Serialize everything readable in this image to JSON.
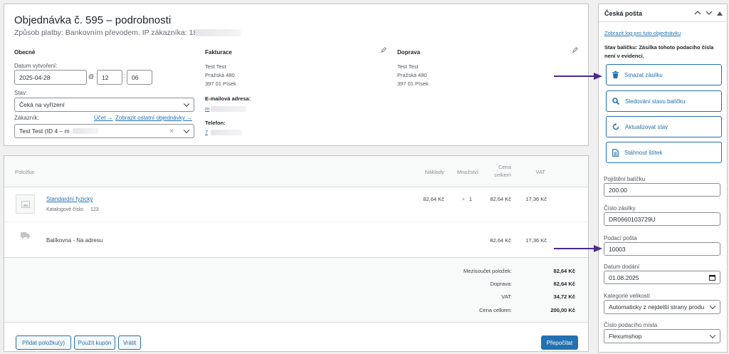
{
  "order": {
    "title": "Objednávka č. 595 – podrobnosti",
    "subtitle": "Způsob platby: Bankovním převodem. IP zákazníka: 18",
    "general": {
      "heading": "Obecné",
      "created_label": "Datum vytvoření:",
      "date": "2025-04-28",
      "at": "@",
      "hour": "12",
      "minute": "06",
      "status_label": "Stav:",
      "status_value": "Čeká na vyřízení",
      "customer_label": "Zákazník:",
      "account_link": "Účet →",
      "other_orders_link": "Zobrazit ostatní objednávky →",
      "customer_value": "Test Test (ID 4 – m",
      "clear": "×"
    },
    "billing": {
      "heading": "Fakturace",
      "lines": [
        "Test Test",
        "Pražská 480",
        "397 01 Písek"
      ],
      "email_label": "E-mailová adresa:",
      "email_value": "m",
      "phone_label": "Telefon:",
      "phone_value": "7"
    },
    "shipping": {
      "heading": "Doprava",
      "lines": [
        "Test Test",
        "Pražská 480",
        "397 01 Písek"
      ]
    }
  },
  "items": {
    "headers": {
      "item": "Položka",
      "cost": "Náklady",
      "qty": "Množství",
      "total_line1": "Cena",
      "total_line2": "celkem",
      "vat": "VAT"
    },
    "product": {
      "name": "Standardní fyzický",
      "sku_label": "Katalogové číslo:",
      "sku": "123",
      "cost": "82,64 Kč",
      "qty_x": "×",
      "qty": "1",
      "total": "82,64 Kč",
      "vat": "17,36 Kč"
    },
    "shipping_line": {
      "name": "Balíkovna - Na adresu",
      "total": "82,64 Kč",
      "vat": "17,36 Kč"
    },
    "totals": [
      {
        "label": "Mezisoučet položek:",
        "value": "82,64 Kč"
      },
      {
        "label": "Doprava:",
        "value": "82,64 Kč"
      },
      {
        "label": "VAT:",
        "value": "34,72 Kč"
      },
      {
        "label": "Cena celkem:",
        "value": "200,00 Kč"
      }
    ],
    "buttons": {
      "add_item": "Přidat položku(y)",
      "coupon": "Použít kupón",
      "refund": "Vrátit",
      "recalc": "Přepočítat"
    }
  },
  "sidebar": {
    "title": "Česká pošta",
    "log_link": "Zobrazit log pro tuto objednávku",
    "status_text": "Stav balíčku: Zásilka tohoto podacího čísla není v evidenci.",
    "actions": [
      {
        "label": "Smazat zásilku",
        "icon": "trash-icon"
      },
      {
        "label": "Sledování stavu balíčku",
        "icon": "search-icon"
      },
      {
        "label": "Aktualizovat stav",
        "icon": "refresh-icon"
      },
      {
        "label": "Stáhnout štítek",
        "icon": "document-icon"
      }
    ],
    "fields": {
      "insurance_label": "Pojištění balíčku",
      "insurance_value": "200.00",
      "shipment_label": "Číslo zásilky",
      "shipment_value": "DR0660103729U",
      "post_office_label": "Podací pošta",
      "post_office_value": "10003",
      "delivery_date_label": "Datum dodání",
      "delivery_date_value": "01.08.2025",
      "size_label": "Kategorie velikosti",
      "size_value": "Automaticky z nejdelší strany produ",
      "location_label": "Číslo podacího místa",
      "location_value": "Flexumshop"
    }
  },
  "colors": {
    "accent": "#2271b1",
    "arrow": "#4b2a8a"
  }
}
